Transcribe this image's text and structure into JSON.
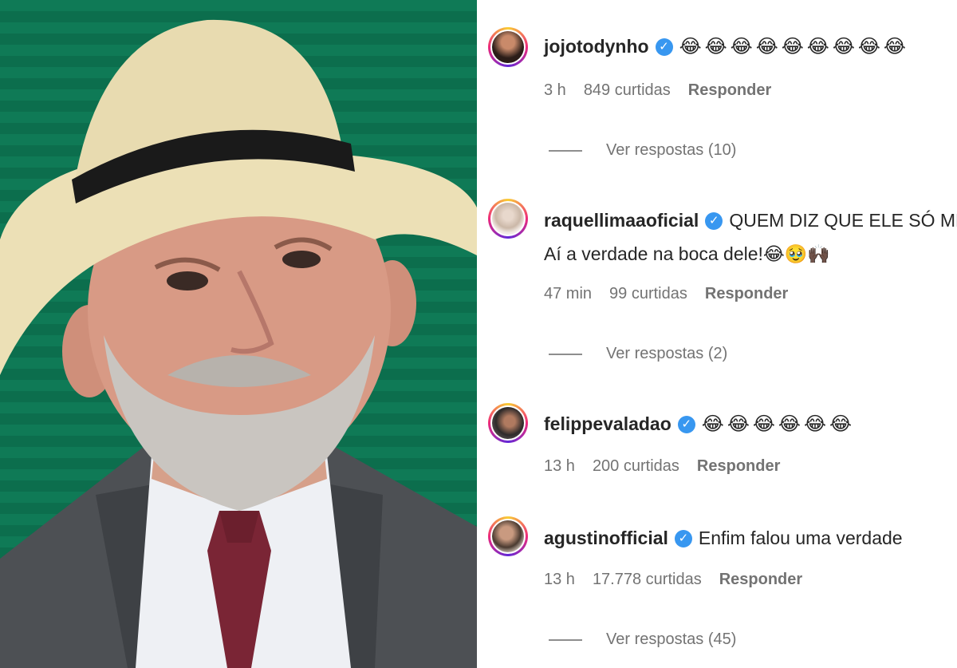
{
  "comments": [
    {
      "username": "jojotodynho",
      "verified": true,
      "text": "",
      "emoji": "😂😂😂😂😂😂😂😂😂",
      "time": "3 h",
      "likes": "849 curtidas",
      "reply_label": "Responder",
      "view_replies": "Ver respostas (10)"
    },
    {
      "username": "raquellimaaoficial",
      "verified": true,
      "text": "QUEM DIZ QUE ELE SÓ ME",
      "text_line2": "Aí a verdade na boca dele!😂🥹🙌🏿",
      "time": "47 min",
      "likes": "99 curtidas",
      "reply_label": "Responder",
      "view_replies": "Ver respostas (2)"
    },
    {
      "username": "felippevaladao",
      "verified": true,
      "text": "",
      "emoji": "😂😂😂😂😂😂",
      "time": "13 h",
      "likes": "200 curtidas",
      "reply_label": "Responder"
    },
    {
      "username": "agustinofficial",
      "verified": true,
      "text": "Enfim falou uma verdade",
      "time": "13 h",
      "likes": "17.778 curtidas",
      "reply_label": "Responder",
      "view_replies": "Ver respostas (45)"
    }
  ],
  "icons": {
    "verified": "verified-badge-icon"
  },
  "colors": {
    "verified_blue": "#3897f0",
    "background_green": "#0f7a56",
    "meta_gray": "#737373"
  }
}
